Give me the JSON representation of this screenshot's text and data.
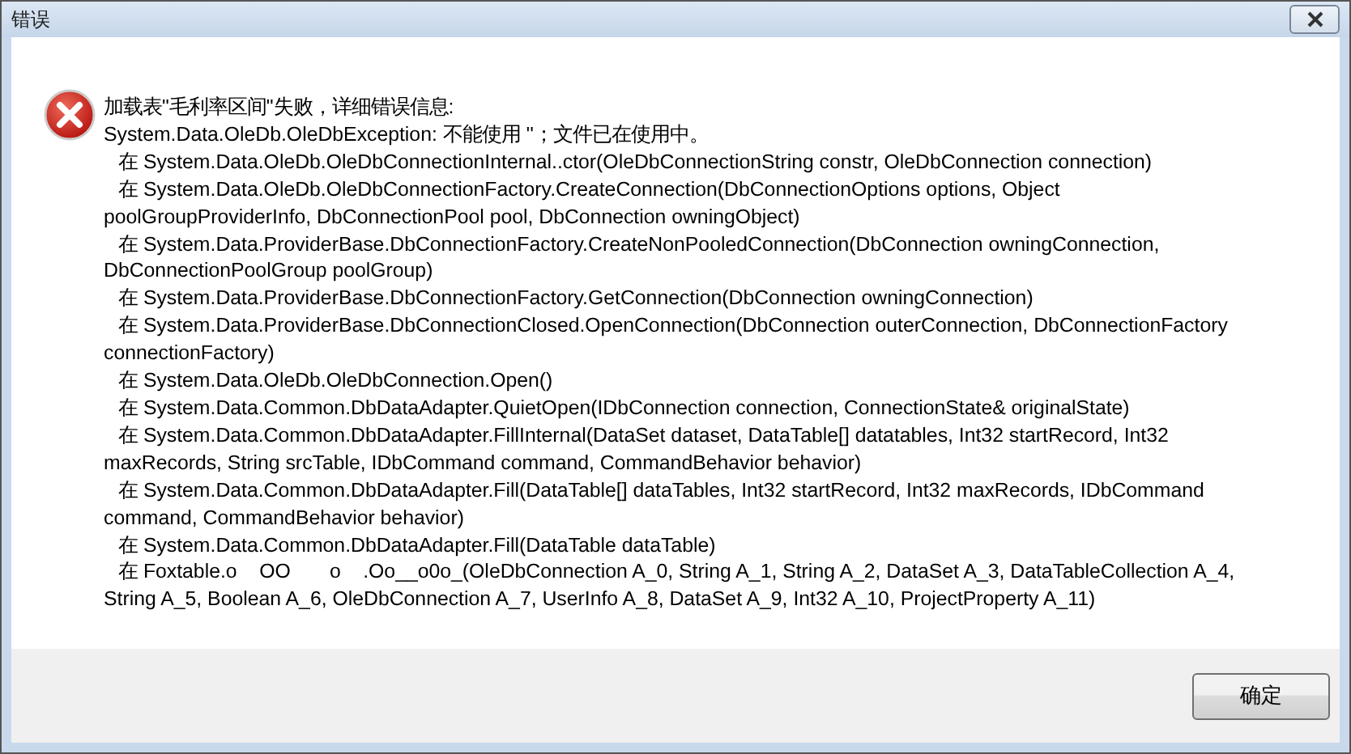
{
  "window": {
    "title": "错误"
  },
  "message_lines": [
    {
      "kind": "header",
      "text": "加载表\"毛利率区间\"失败，详细错误信息:"
    },
    {
      "kind": "header",
      "text": "System.Data.OleDb.OleDbException: 不能使用 ''；文件已在使用中。"
    },
    {
      "kind": "frame",
      "text": "在 System.Data.OleDb.OleDbConnectionInternal..ctor(OleDbConnectionString constr, OleDbConnection connection)"
    },
    {
      "kind": "frame",
      "text": "在 System.Data.OleDb.OleDbConnectionFactory.CreateConnection(DbConnectionOptions options, Object"
    },
    {
      "kind": "wrap",
      "text": "poolGroupProviderInfo, DbConnectionPool pool, DbConnection owningObject)"
    },
    {
      "kind": "frame",
      "text": "在 System.Data.ProviderBase.DbConnectionFactory.CreateNonPooledConnection(DbConnection owningConnection,"
    },
    {
      "kind": "wrap",
      "text": "DbConnectionPoolGroup poolGroup)"
    },
    {
      "kind": "frame",
      "text": "在 System.Data.ProviderBase.DbConnectionFactory.GetConnection(DbConnection owningConnection)"
    },
    {
      "kind": "frame",
      "text": "在 System.Data.ProviderBase.DbConnectionClosed.OpenConnection(DbConnection outerConnection, DbConnectionFactory"
    },
    {
      "kind": "wrap",
      "text": "connectionFactory)"
    },
    {
      "kind": "frame",
      "text": "在 System.Data.OleDb.OleDbConnection.Open()"
    },
    {
      "kind": "frame",
      "text": "在 System.Data.Common.DbDataAdapter.QuietOpen(IDbConnection connection, ConnectionState& originalState)"
    },
    {
      "kind": "frame",
      "text": "在 System.Data.Common.DbDataAdapter.FillInternal(DataSet dataset, DataTable[] datatables, Int32 startRecord, Int32"
    },
    {
      "kind": "wrap",
      "text": "maxRecords, String srcTable, IDbCommand command, CommandBehavior behavior)"
    },
    {
      "kind": "frame",
      "text": "在 System.Data.Common.DbDataAdapter.Fill(DataTable[] dataTables, Int32 startRecord, Int32 maxRecords, IDbCommand"
    },
    {
      "kind": "wrap",
      "text": "command, CommandBehavior behavior)"
    },
    {
      "kind": "frame",
      "text": "在 System.Data.Common.DbDataAdapter.Fill(DataTable dataTable)"
    },
    {
      "kind": "frame",
      "text": "在 Foxtable.o    OO       o    .Oo__o0o_(OleDbConnection A_0, String A_1, String A_2, DataSet A_3, DataTableCollection A_4,"
    },
    {
      "kind": "wrap",
      "text": "String A_5, Boolean A_6, OleDbConnection A_7, UserInfo A_8, DataSet A_9, Int32 A_10, ProjectProperty A_11)"
    }
  ],
  "buttons": [
    {
      "label": "确定"
    }
  ]
}
